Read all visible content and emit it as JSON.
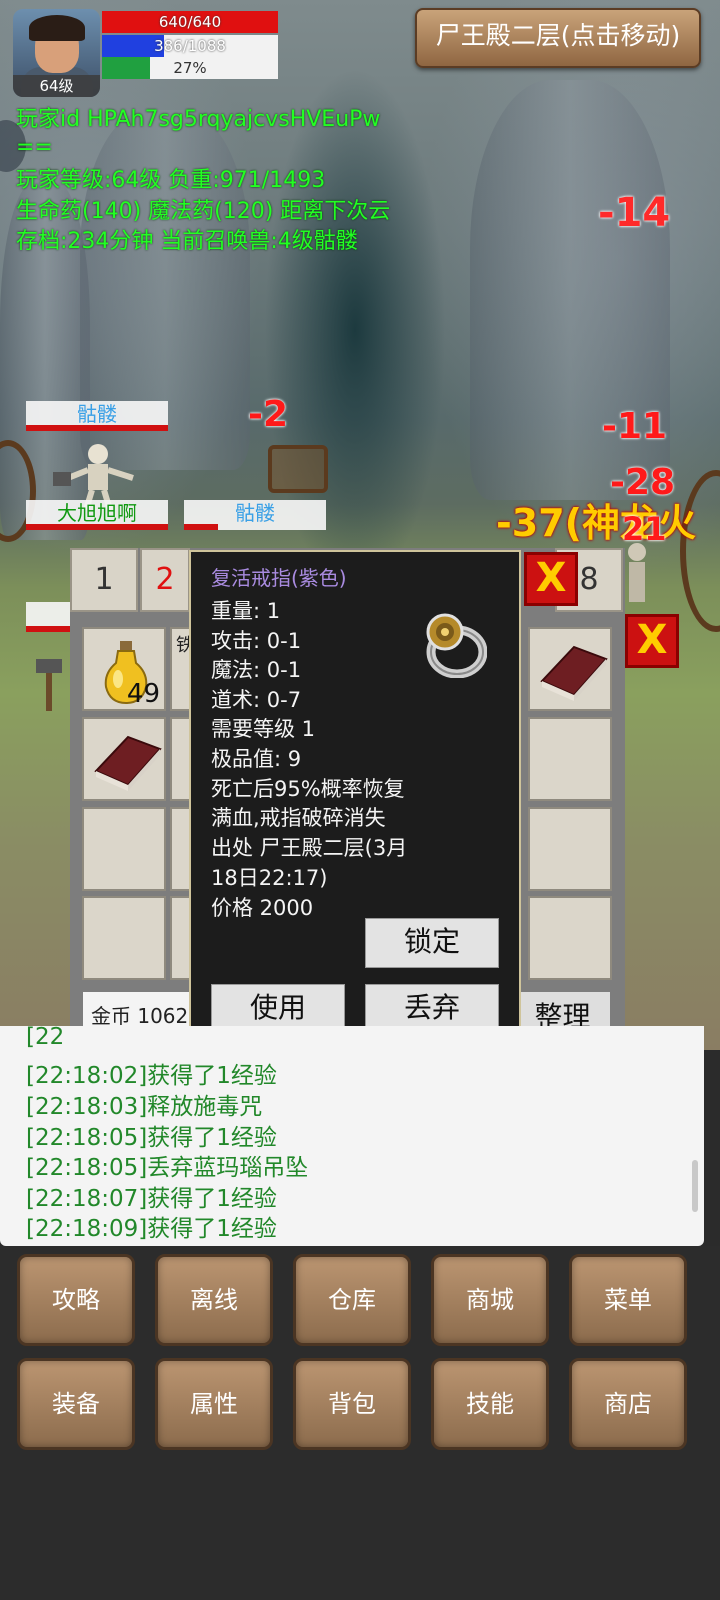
{
  "player": {
    "level_badge": "64级",
    "hp_text": "640/640",
    "hp_fraction": 1.0,
    "mp_text": "386/1088",
    "mp_fraction": 0.35,
    "exp_text": "27%",
    "exp_fraction": 0.27
  },
  "map_button": "尸王殿二层(点击移动)",
  "info_lines": [
    "玩家id HPAh7sg5rqyajcvsHVEuPw",
    "==",
    "玩家等级:64级 负重:971/1493",
    "生命药(140) 魔法药(120) 距离下次云",
    "存档:234分钟 当前召唤兽:4级骷髅"
  ],
  "damage_numbers": {
    "d1": "-14",
    "d2": "-2",
    "d3": "-11",
    "d4": "-28",
    "d5": "-37(神龙火",
    "d6": "21"
  },
  "nameplates": {
    "skeleton_1": "骷髅",
    "player": "大旭旭啊",
    "skeleton_2": "骷髅"
  },
  "bag_tabs": [
    "1",
    "2",
    "8"
  ],
  "close_symbol": "X",
  "slots": {
    "potion_count": "49",
    "partial_text": "铁"
  },
  "gold_label": "金币 1062",
  "sort_button": "整理",
  "item_tooltip": {
    "name": "复活戒指(紫色)",
    "weight": "重量: 1",
    "attack": "攻击: 0-1",
    "magic": "魔法: 0-1",
    "taoism": "道术: 0-7",
    "required_level": "需要等级 1",
    "quality": "极品值: 9",
    "desc_1": "死亡后95%概率恢复",
    "desc_2": "满血,戒指破碎消失",
    "source_1": "出处 尸王殿二层(3月",
    "source_2": "18日22:17)",
    "price": "价格 2000",
    "lock_button": "锁定",
    "use_button": "使用",
    "discard_button": "丢弃"
  },
  "log": {
    "partial_top": "[22",
    "rows": [
      "[22:18:02]获得了1经验",
      "[22:18:03]释放施毒咒",
      "[22:18:05]获得了1经验",
      "[22:18:05]丢弃蓝玛瑙吊坠",
      "[22:18:07]获得了1经验",
      "[22:18:09]获得了1经验"
    ]
  },
  "menu_row1": [
    "攻略",
    "离线",
    "仓库",
    "商城",
    "菜单"
  ],
  "menu_row2": [
    "装备",
    "属性",
    "背包",
    "技能",
    "商店"
  ],
  "colors": {
    "info_text": "#22ff22",
    "damage": "#ff1a1a",
    "log_text": "#22882a",
    "item_name_purple": "#a98be0",
    "hp_bar": "#e01010",
    "mp_bar": "#2040e0",
    "exp_bar": "#20a040"
  },
  "icons": [
    "avatar-portrait",
    "potion-icon",
    "book-icon",
    "ring-icon",
    "close-icon",
    "skeleton-sprite"
  ]
}
